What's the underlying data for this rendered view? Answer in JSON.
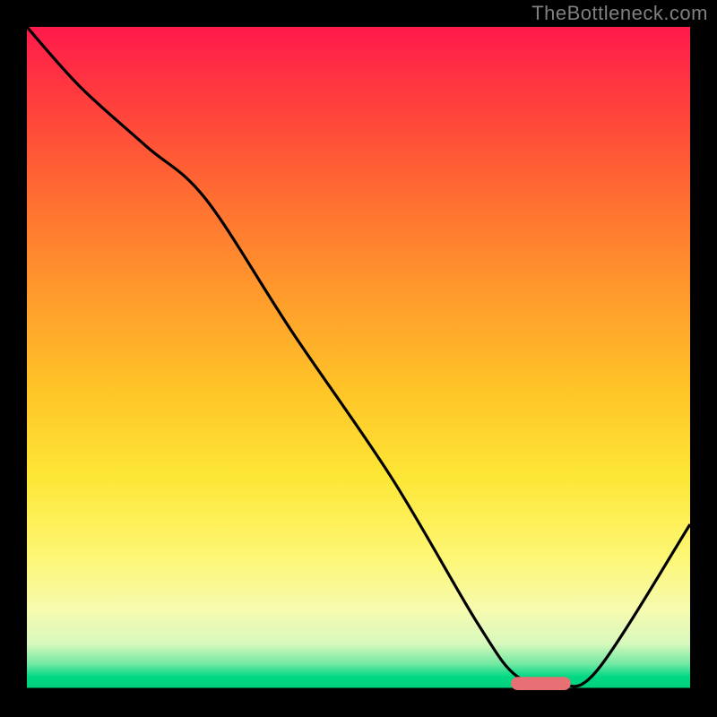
{
  "attribution": "TheBottleneck.com",
  "chart_data": {
    "type": "line",
    "title": "",
    "xlabel": "",
    "ylabel": "",
    "xlim": [
      0,
      100
    ],
    "ylim": [
      0,
      100
    ],
    "background_gradient": {
      "direction": "vertical",
      "stops": [
        {
          "pos": 0,
          "color": "#ff1a4c"
        },
        {
          "pos": 25,
          "color": "#ff6b32"
        },
        {
          "pos": 55,
          "color": "#ffc528"
        },
        {
          "pos": 80,
          "color": "#fdf775"
        },
        {
          "pos": 96,
          "color": "#74e9a3"
        },
        {
          "pos": 100,
          "color": "#00cf7c"
        }
      ]
    },
    "series": [
      {
        "name": "bottleneck-curve",
        "x": [
          0,
          8,
          18,
          27,
          40,
          55,
          68,
          74,
          80,
          86,
          100
        ],
        "y": [
          100,
          91,
          82,
          74,
          54,
          32,
          10,
          2,
          1,
          3,
          25
        ]
      }
    ],
    "marker": {
      "name": "optimal-range",
      "shape": "capsule",
      "color": "#e86f73",
      "x": 77.5,
      "y": 1,
      "width": 9,
      "height": 2
    },
    "annotations": []
  }
}
